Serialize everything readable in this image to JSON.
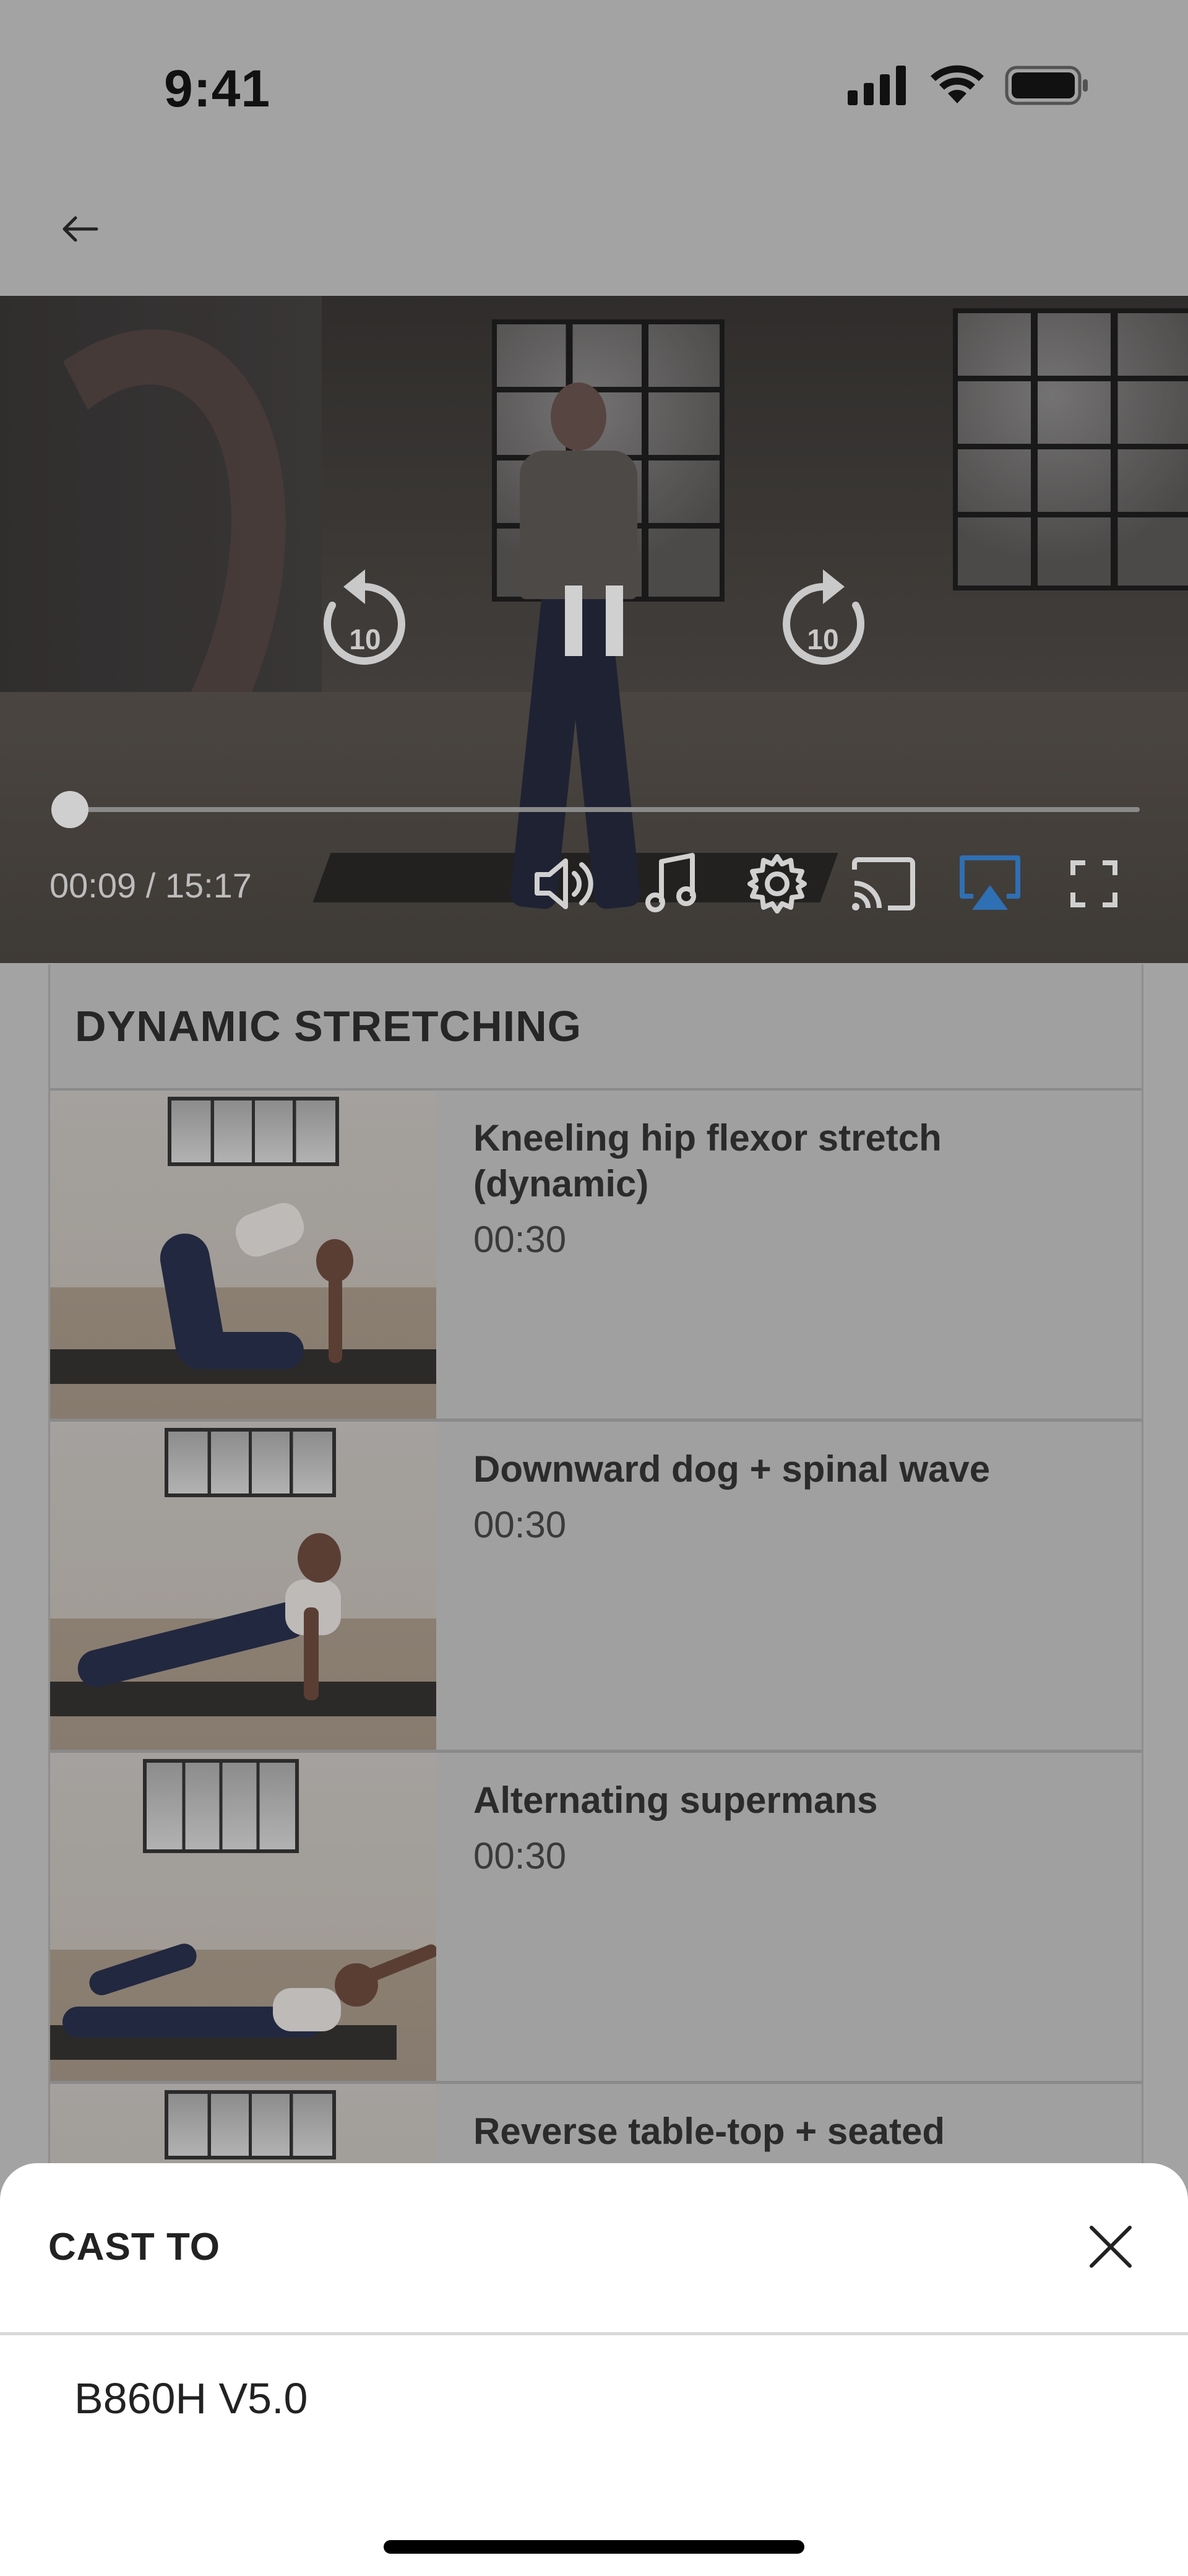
{
  "status_bar": {
    "time": "9:41",
    "icons": [
      "signal-icon",
      "wifi-icon",
      "battery-icon"
    ]
  },
  "header": {
    "back_icon": "arrow-left-icon"
  },
  "player": {
    "rewind_seconds": "10",
    "forward_seconds": "10",
    "timecode": "00:09 / 15:17",
    "progress_fraction": 0.01,
    "toolbar_icons": [
      "volume-icon",
      "music-icon",
      "settings-icon",
      "cast-icon",
      "airplay-icon",
      "fullscreen-icon"
    ],
    "active_icon": "airplay-icon",
    "accent_color": "#2f6fb3"
  },
  "section": {
    "title": "DYNAMIC STRETCHING"
  },
  "exercises": [
    {
      "name": "Kneeling hip flexor stretch (dynamic)",
      "duration": "00:30"
    },
    {
      "name": "Downward dog + spinal wave",
      "duration": "00:30"
    },
    {
      "name": "Alternating supermans",
      "duration": "00:30"
    },
    {
      "name": "Reverse table-top + seated",
      "duration": ""
    }
  ],
  "cast_sheet": {
    "title": "CAST TO",
    "close_icon": "close-icon",
    "devices": [
      "B860H V5.0"
    ]
  }
}
